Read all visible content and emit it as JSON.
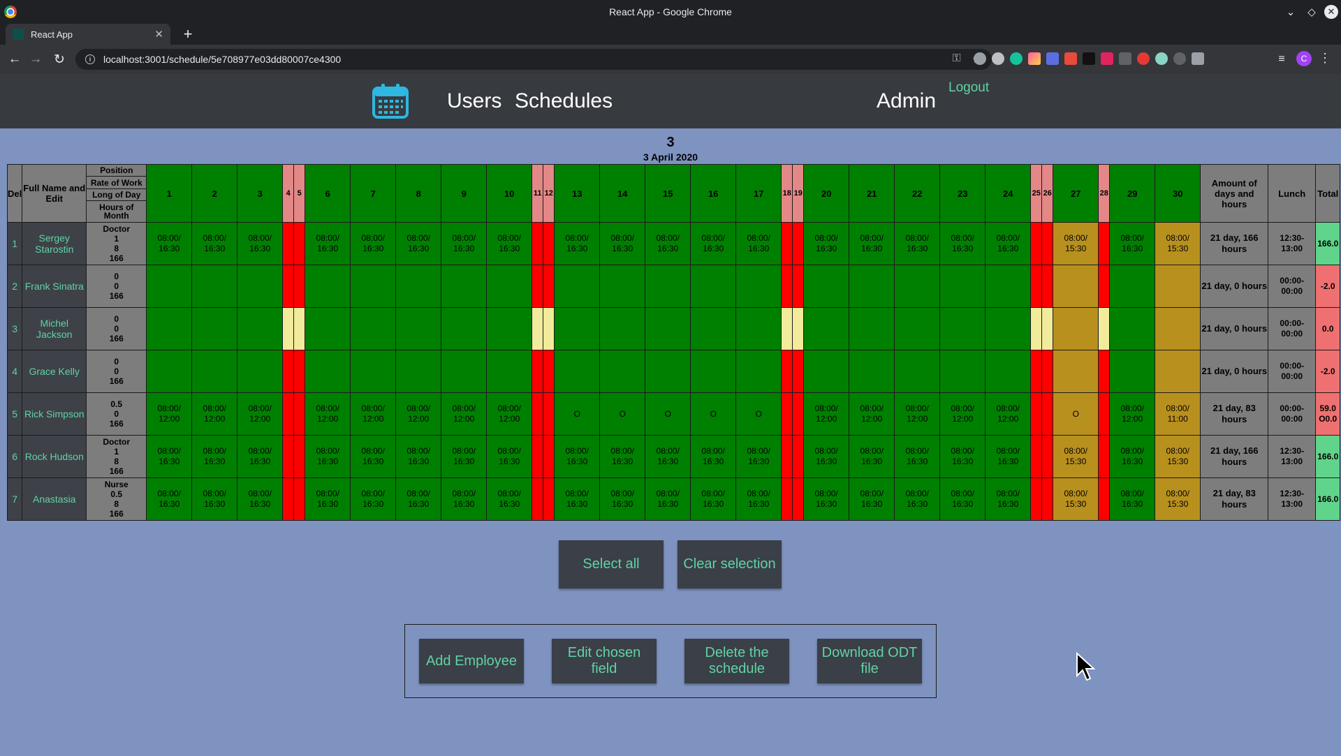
{
  "browser": {
    "window_title": "React App - Google Chrome",
    "tab_title": "React App",
    "url": "localhost:3001/schedule/5e708977e03dd80007ce4300",
    "profile_initial": "C"
  },
  "header": {
    "nav_users": "Users",
    "nav_schedules": "Schedules",
    "user_role": "Admin",
    "logout": "Logout"
  },
  "schedule": {
    "title": "3",
    "date": "3 April 2020"
  },
  "table": {
    "header": {
      "del": "Del",
      "full_name": "Full Name and Edit",
      "position": "Position",
      "rate": "Rate of Work",
      "long_day": "Long of Day",
      "hours_month": "Hours of Month",
      "amount": "Amount of days and hours",
      "lunch": "Lunch",
      "total": "Total"
    },
    "day_kinds": [
      "w",
      "w",
      "w",
      "h",
      "h",
      "w",
      "w",
      "w",
      "w",
      "w",
      "h",
      "h",
      "w",
      "w",
      "w",
      "w",
      "w",
      "h",
      "h",
      "w",
      "w",
      "w",
      "w",
      "w",
      "h",
      "h",
      "f",
      "h",
      "w",
      "f"
    ],
    "days": [
      "1",
      "2",
      "3",
      "4",
      "5",
      "6",
      "7",
      "8",
      "9",
      "10",
      "11",
      "12",
      "13",
      "14",
      "15",
      "16",
      "17",
      "18",
      "19",
      "20",
      "21",
      "22",
      "23",
      "24",
      "25",
      "26",
      "27",
      "28",
      "29",
      "30"
    ],
    "rows": [
      {
        "num": "1",
        "name": "Sergey Starostin",
        "info": [
          "Doctor",
          "1",
          "8",
          "166"
        ],
        "fill": "hd",
        "std": "08:00/ 16:30",
        "short": "08:00/ 15:30",
        "special": {},
        "sum": "21 day, 166 hours",
        "lunch": "12:30- 13:00",
        "total": "166.0",
        "total_color": "green"
      },
      {
        "num": "2",
        "name": "Frank Sinatra",
        "info": [
          "0",
          "0",
          "166"
        ],
        "fill": "hd",
        "std": "",
        "short": "",
        "special": {},
        "sum": "21 day, 0 hours",
        "lunch": "00:00- 00:00",
        "total": "-2.0",
        "total_color": "red"
      },
      {
        "num": "3",
        "name": "Michel Jackson",
        "info": [
          "0",
          "0",
          "166"
        ],
        "fill": "hy",
        "std": "",
        "short": "",
        "special": {},
        "sum": "21 day, 0 hours",
        "lunch": "00:00- 00:00",
        "total": "0.0",
        "total_color": "red"
      },
      {
        "num": "4",
        "name": "Grace Kelly",
        "info": [
          "0",
          "0",
          "166"
        ],
        "fill": "hd",
        "std": "",
        "short": "",
        "special": {},
        "sum": "21 day, 0 hours",
        "lunch": "00:00- 00:00",
        "total": "-2.0",
        "total_color": "red"
      },
      {
        "num": "5",
        "name": "Rick Simpson",
        "info": [
          "0.5",
          "0",
          "166"
        ],
        "fill": "hd",
        "std": "08:00/ 12:00",
        "short": "08:00/ 11:00",
        "special": {
          "12": "O",
          "13": "O",
          "14": "O",
          "15": "O",
          "16": "O",
          "26": "O"
        },
        "sum": "21 day, 83 hours",
        "lunch": "00:00- 00:00",
        "total": "59.0 O0.0",
        "total_color": "red"
      },
      {
        "num": "6",
        "name": "Rock Hudson",
        "info": [
          "Doctor",
          "1",
          "8",
          "166"
        ],
        "fill": "hd",
        "std": "08:00/ 16:30",
        "short": "08:00/ 15:30",
        "special": {},
        "sum": "21 day, 166 hours",
        "lunch": "12:30- 13:00",
        "total": "166.0",
        "total_color": "green"
      },
      {
        "num": "7",
        "name": "Anastasia",
        "info": [
          "Nurse",
          "0.5",
          "8",
          "166"
        ],
        "fill": "hd",
        "std": "08:00/ 16:30",
        "short": "08:00/ 15:30",
        "special": {},
        "sum": "21 day, 83 hours",
        "lunch": "12:30- 13:00",
        "total": "166.0",
        "total_color": "green"
      }
    ]
  },
  "buttons": {
    "select_all": "Select all",
    "clear_selection": "Clear selection",
    "add_employee": "Add Employee",
    "edit_field": "Edit chosen field",
    "delete_schedule": "Delete the schedule",
    "download_odt": "Download ODT file"
  },
  "colors": {
    "page_bg": "#7f93c1",
    "header_bg": "#373b40",
    "accent": "#60d3a3",
    "workday": "#008000",
    "short_day": "#b8901e",
    "holiday": "#ff0000",
    "holiday_marked": "#f1eb9b"
  }
}
